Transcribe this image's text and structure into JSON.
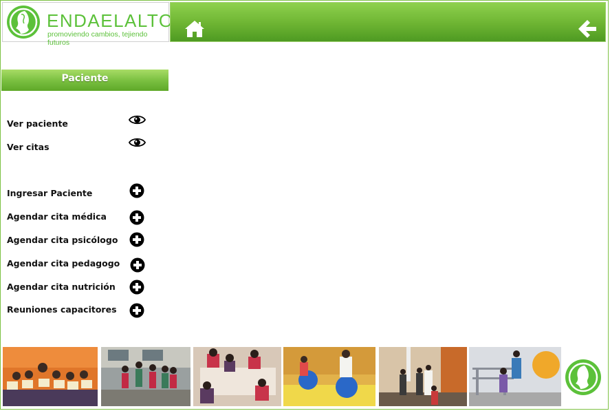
{
  "brand": {
    "name": "ENDAELALTO",
    "tagline": "promoviendo cambios, tejiendo futuros",
    "color": "#5cc13a"
  },
  "topbar": {
    "home_icon": "home-icon",
    "back_icon": "arrow-left-icon"
  },
  "sidebar": {
    "title": "Paciente",
    "view_items": [
      {
        "label": "Ver paciente",
        "icon": "eye-icon"
      },
      {
        "label": "Ver citas",
        "icon": "eye-icon"
      }
    ],
    "add_items": [
      {
        "label": "Ingresar Paciente",
        "icon": "plus-circle-icon"
      },
      {
        "label": "Agendar cita médica",
        "icon": "plus-circle-icon"
      },
      {
        "label": "Agendar cita psicólogo",
        "icon": "plus-circle-icon"
      },
      {
        "label": "Agendar cita pedagogo",
        "icon": "plus-circle-icon"
      },
      {
        "label": "Agendar cita nutrición",
        "icon": "plus-circle-icon"
      },
      {
        "label": "Reuniones capacitores",
        "icon": "plus-circle-icon"
      }
    ]
  },
  "gallery": {
    "photos": [
      "group-photo-orange-room",
      "children-jumping-outdoors",
      "children-drawing-table",
      "therapy-balls-room",
      "hallway-group",
      "therapy-parallel-bars"
    ]
  },
  "colors": {
    "accent": "#7cc142",
    "header_dark": "#4e9a22"
  }
}
